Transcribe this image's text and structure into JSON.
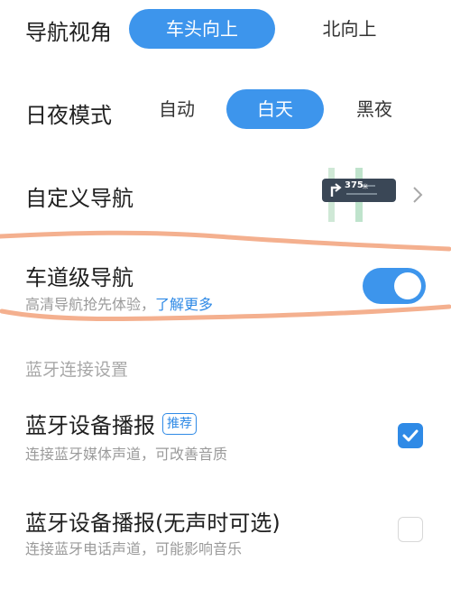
{
  "view_mode": {
    "label": "导航视角",
    "options": [
      "车头向上",
      "北向上"
    ],
    "selected": "车头向上"
  },
  "day_night": {
    "label": "日夜模式",
    "options": [
      "自动",
      "白天",
      "黑夜"
    ],
    "selected": "白天"
  },
  "custom_nav": {
    "label": "自定义导航",
    "preview_distance": "375",
    "preview_unit": "米"
  },
  "lane_nav": {
    "label": "车道级导航",
    "desc": "高清导航抢先体验，",
    "link": "了解更多",
    "enabled": true
  },
  "bluetooth_section": {
    "title": "蓝牙连接设置"
  },
  "bt_media": {
    "label": "蓝牙设备播报",
    "badge": "推荐",
    "desc": "连接蓝牙媒体声道，可改善音质",
    "checked": true
  },
  "bt_phone": {
    "label": "蓝牙设备播报(无声时可选)",
    "desc": "连接蓝牙电话声道，可能影响音乐",
    "checked": false
  },
  "colors": {
    "accent": "#3d95ec",
    "link": "#2f8ae6",
    "annotation": "#f4b08f"
  },
  "icons": [
    "chevron-right-icon",
    "check-icon",
    "turn-left-icon"
  ]
}
